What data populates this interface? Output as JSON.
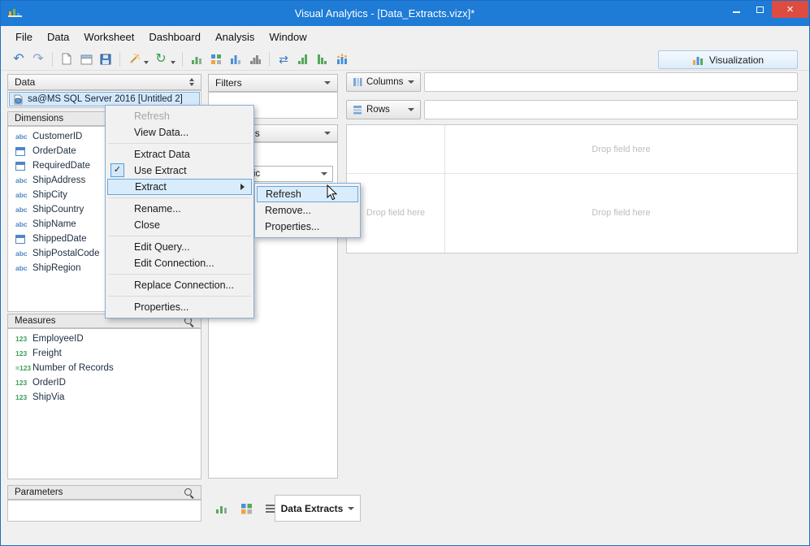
{
  "window": {
    "title": "Visual Analytics - [Data_Extracts.vizx]*",
    "controls": {
      "close": "×"
    }
  },
  "colors": {
    "titlebar": "#1e7bd6",
    "close_button": "#dc4c41",
    "menu_highlight": "#d9ecfc",
    "selection": "#d6e9f9"
  },
  "menubar": {
    "items": [
      {
        "label": "File"
      },
      {
        "label": "Data"
      },
      {
        "label": "Worksheet"
      },
      {
        "label": "Dashboard"
      },
      {
        "label": "Analysis"
      },
      {
        "label": "Window"
      }
    ]
  },
  "toolbar": {
    "visualization": "Visualization",
    "icon_names": [
      "undo-icon",
      "redo-icon",
      "new-sheet-icon",
      "new-window-icon",
      "save-icon",
      "wand-icon",
      "refresh-icon",
      "bar-chart-icon",
      "chart-grid-icon",
      "column-chart-icon",
      "histogram-icon",
      "swap-axes-icon",
      "sort-ascending-icon",
      "sort-descending-icon",
      "show-labels-icon"
    ]
  },
  "icons": {
    "abc": "abc",
    "num": "123",
    "calc": "=123",
    "check": "✓"
  },
  "data_panel": {
    "title": "Data",
    "source_label": "sa@MS SQL Server 2016 [Untitled 2]",
    "dimensions": {
      "title": "Dimensions",
      "items": [
        {
          "type": "abc",
          "label": "CustomerID"
        },
        {
          "type": "date",
          "label": "OrderDate"
        },
        {
          "type": "date",
          "label": "RequiredDate"
        },
        {
          "type": "abc",
          "label": "ShipAddress"
        },
        {
          "type": "abc",
          "label": "ShipCity"
        },
        {
          "type": "abc",
          "label": "ShipCountry"
        },
        {
          "type": "abc",
          "label": "ShipName"
        },
        {
          "type": "date",
          "label": "ShippedDate"
        },
        {
          "type": "abc",
          "label": "ShipPostalCode"
        },
        {
          "type": "abc",
          "label": "ShipRegion"
        }
      ]
    },
    "measures": {
      "title": "Measures",
      "items": [
        {
          "type": "num",
          "label": "EmployeeID"
        },
        {
          "type": "num",
          "label": "Freight"
        },
        {
          "type": "calc",
          "label": "Number of Records"
        },
        {
          "type": "num",
          "label": "OrderID"
        },
        {
          "type": "num",
          "label": "ShipVia"
        }
      ]
    },
    "parameters": {
      "title": "Parameters"
    }
  },
  "panels": {
    "filters": {
      "title": "Filters"
    },
    "properties": {
      "title": "Properties",
      "marks_value": "Automatic"
    }
  },
  "shelves": {
    "columns": "Columns",
    "rows": "Rows"
  },
  "canvas": {
    "drop_hint": "Drop field here"
  },
  "context_menu": {
    "items": [
      {
        "label": "Refresh",
        "disabled": true
      },
      {
        "label": "View Data..."
      },
      {
        "label": "Extract Data"
      },
      {
        "label": "Use Extract",
        "checked": true
      },
      {
        "label": "Extract",
        "submenu": true,
        "highlighted": true
      },
      {
        "label": "Rename..."
      },
      {
        "label": "Close"
      },
      {
        "label": "Edit Query..."
      },
      {
        "label": "Edit Connection..."
      },
      {
        "label": "Replace Connection..."
      },
      {
        "label": "Properties..."
      }
    ]
  },
  "submenu": {
    "items": [
      {
        "label": "Refresh",
        "highlighted": true
      },
      {
        "label": "Remove..."
      },
      {
        "label": "Properties..."
      }
    ]
  },
  "bottom_bar": {
    "tab_label": "Data Extracts"
  }
}
